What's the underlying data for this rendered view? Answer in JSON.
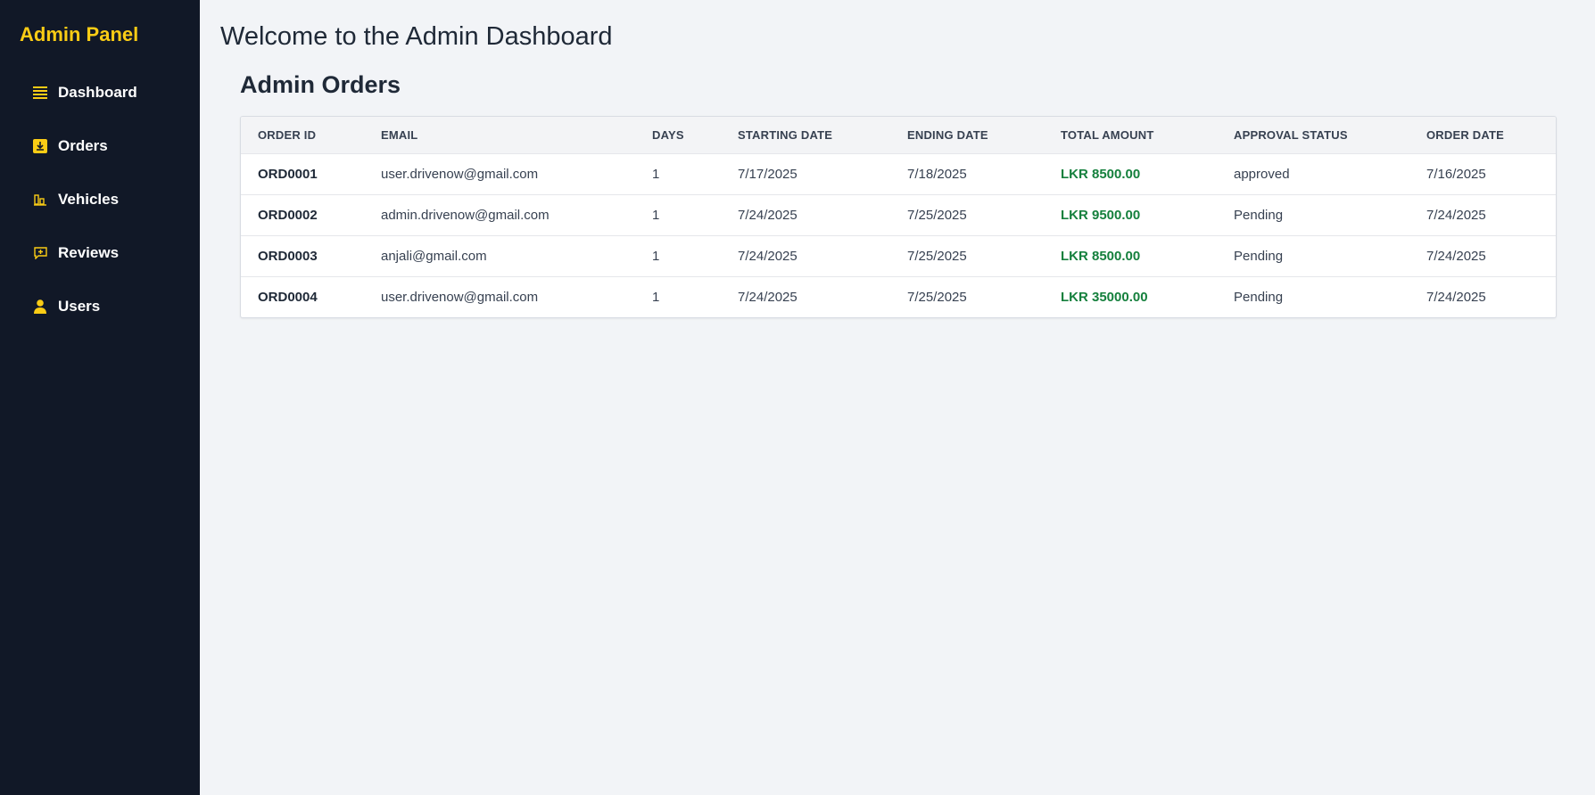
{
  "sidebar": {
    "brand": "Admin Panel",
    "items": [
      {
        "label": "Dashboard",
        "icon": "list-icon"
      },
      {
        "label": "Orders",
        "icon": "download-icon"
      },
      {
        "label": "Vehicles",
        "icon": "bar-chart-icon"
      },
      {
        "label": "Reviews",
        "icon": "message-plus-icon"
      },
      {
        "label": "Users",
        "icon": "user-icon"
      }
    ]
  },
  "colors": {
    "accent": "#facc15",
    "sidebar_bg": "#111827",
    "amount": "#15803d"
  },
  "main": {
    "title": "Welcome to the Admin Dashboard",
    "section_title": "Admin Orders",
    "table": {
      "columns": [
        "ORDER ID",
        "EMAIL",
        "DAYS",
        "STARTING DATE",
        "ENDING DATE",
        "TOTAL AMOUNT",
        "APPROVAL STATUS",
        "ORDER DATE"
      ],
      "rows": [
        [
          "ORD0001",
          "user.drivenow@gmail.com",
          "1",
          "7/17/2025",
          "7/18/2025",
          "LKR 8500.00",
          "approved",
          "7/16/2025"
        ],
        [
          "ORD0002",
          "admin.drivenow@gmail.com",
          "1",
          "7/24/2025",
          "7/25/2025",
          "LKR 9500.00",
          "Pending",
          "7/24/2025"
        ],
        [
          "ORD0003",
          "anjali@gmail.com",
          "1",
          "7/24/2025",
          "7/25/2025",
          "LKR 8500.00",
          "Pending",
          "7/24/2025"
        ],
        [
          "ORD0004",
          "user.drivenow@gmail.com",
          "1",
          "7/24/2025",
          "7/25/2025",
          "LKR 35000.00",
          "Pending",
          "7/24/2025"
        ]
      ]
    }
  }
}
